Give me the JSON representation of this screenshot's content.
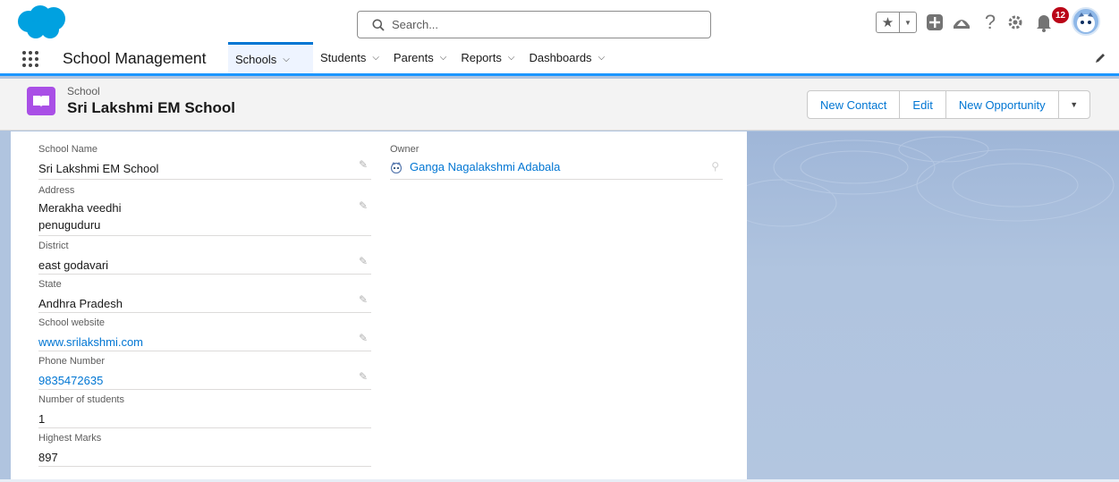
{
  "header": {
    "search_placeholder": "Search...",
    "notification_count": "12"
  },
  "nav": {
    "app_name": "School Management",
    "tabs": [
      {
        "label": "Schools"
      },
      {
        "label": "Students"
      },
      {
        "label": "Parents"
      },
      {
        "label": "Reports"
      },
      {
        "label": "Dashboards"
      }
    ]
  },
  "record": {
    "type": "School",
    "title": "Sri Lakshmi EM School",
    "actions": {
      "new_contact": "New Contact",
      "edit": "Edit",
      "new_opportunity": "New Opportunity"
    }
  },
  "fields": {
    "school_name": {
      "label": "School Name",
      "value": "Sri Lakshmi EM School"
    },
    "address": {
      "label": "Address",
      "line1": "Merakha veedhi",
      "line2": "penuguduru"
    },
    "district": {
      "label": "District",
      "value": "east godavari"
    },
    "state": {
      "label": "State",
      "value": "Andhra Pradesh"
    },
    "website": {
      "label": "School website",
      "value": "www.srilakshmi.com"
    },
    "phone": {
      "label": "Phone Number",
      "value": "9835472635"
    },
    "students": {
      "label": "Number of students",
      "value": "1"
    },
    "marks": {
      "label": "Highest Marks",
      "value": "897"
    },
    "owner": {
      "label": "Owner",
      "value": "Ganga Nagalakshmi Adabala"
    }
  },
  "colors": {
    "brand_blue": "#0176d3",
    "record_icon": "#a94fe6",
    "badge_red": "#ba0517"
  }
}
